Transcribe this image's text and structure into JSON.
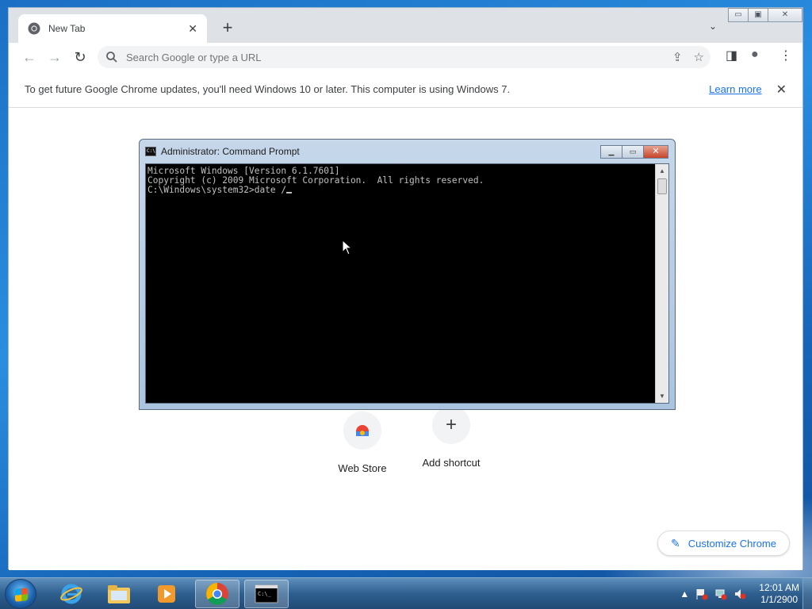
{
  "browser": {
    "tab_title": "New Tab",
    "tab_close": "✕",
    "new_tab": "+",
    "tab_search": "⌄",
    "win_min": "▭",
    "win_max": "▣",
    "win_close": "✕",
    "back": "←",
    "forward": "→",
    "reload": "↻",
    "omnibox_placeholder": "Search Google or type a URL",
    "share_icon": "⇪",
    "star_icon": "☆",
    "sidepanel_icon": "◨",
    "profile_icon": "●",
    "menu_icon": "⋮"
  },
  "infobar": {
    "message": "To get future Google Chrome updates, you'll need Windows 10 or later. This computer is using Windows 7.",
    "learn_more": "Learn more",
    "close": "✕"
  },
  "ntp": {
    "shortcuts": [
      {
        "label": "Web Store"
      },
      {
        "label": "Add shortcut",
        "icon": "+"
      }
    ],
    "customize_label": "Customize Chrome",
    "customize_icon": "✎"
  },
  "cmd": {
    "title": "Administrator: Command Prompt",
    "icon_text": "C:\\",
    "min": "▁",
    "max": "▭",
    "close": "✕",
    "lines": [
      "Microsoft Windows [Version 6.1.7601]",
      "Copyright (c) 2009 Microsoft Corporation.  All rights reserved.",
      "",
      "C:\\Windows\\system32>date /"
    ]
  },
  "taskbar": {
    "clock_time": "12:01 AM",
    "clock_date": "1/1/2900",
    "tray_arrow": "▲"
  },
  "colors": {
    "accent": "#1a73e8",
    "taskbar": "#2e5f8f",
    "cmd_bg": "#000000",
    "cmd_text": "#c0c0c0"
  }
}
